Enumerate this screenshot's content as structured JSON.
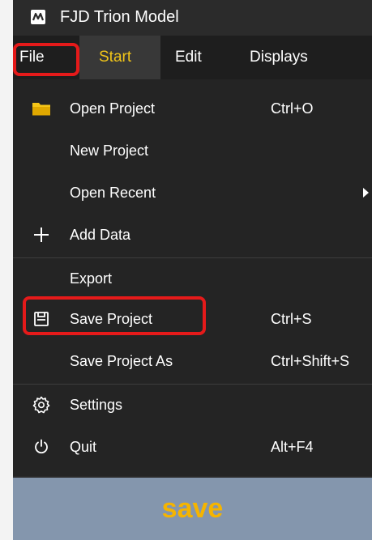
{
  "window": {
    "title": "FJD Trion Model"
  },
  "menubar": {
    "file": "File",
    "start": "Start",
    "edit": "Edit",
    "displays": "Displays"
  },
  "menu": {
    "items": [
      {
        "label": "Open Project",
        "shortcut": "Ctrl+O",
        "icon": "folder-icon"
      },
      {
        "label": "New Project",
        "shortcut": ""
      },
      {
        "label": "Open Recent",
        "shortcut": "",
        "submenu": true
      },
      {
        "label": "Add Data",
        "shortcut": "",
        "icon": "plus-icon"
      },
      {
        "label": "Export",
        "shortcut": ""
      },
      {
        "label": "Save Project",
        "shortcut": "Ctrl+S",
        "icon": "save-icon",
        "highlighted": true
      },
      {
        "label": "Save Project As",
        "shortcut": "Ctrl+Shift+S"
      },
      {
        "label": "Settings",
        "shortcut": "",
        "icon": "gear-icon"
      },
      {
        "label": "Quit",
        "shortcut": "Alt+F4",
        "icon": "power-icon"
      }
    ]
  },
  "annotation": {
    "caption": "save"
  },
  "colors": {
    "highlight_box": "#e51a1a",
    "active_menu_text": "#f0c419",
    "caption_bg": "#8496ad",
    "caption_text": "#f5b400",
    "folder_icon": "#f5c518"
  }
}
